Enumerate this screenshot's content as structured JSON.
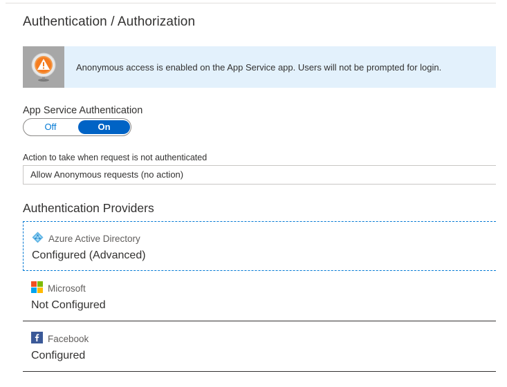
{
  "page": {
    "title": "Authentication / Authorization"
  },
  "banner": {
    "icon": "warning-icon",
    "text": "Anonymous access is enabled on the App Service app. Users will not be prompted for login."
  },
  "app_service_auth": {
    "label": "App Service Authentication",
    "off_label": "Off",
    "on_label": "On",
    "selected": "On"
  },
  "action": {
    "label": "Action to take when request is not authenticated",
    "selected_value": "Allow Anonymous requests (no action)"
  },
  "providers": {
    "title": "Authentication Providers",
    "items": [
      {
        "name": "Azure Active Directory",
        "status": "Configured (Advanced)",
        "icon": "azure-ad-icon"
      },
      {
        "name": "Microsoft",
        "status": "Not Configured",
        "icon": "microsoft-icon"
      },
      {
        "name": "Facebook",
        "status": "Configured",
        "icon": "facebook-icon"
      }
    ]
  },
  "colors": {
    "accent": "#0078d4",
    "toggle_on": "#0063c5",
    "banner_bg": "#e3f1fc",
    "warning": "#f2994a"
  }
}
